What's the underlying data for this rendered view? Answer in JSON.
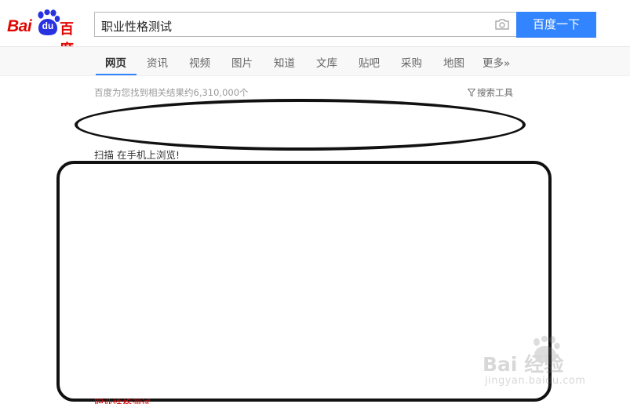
{
  "logo": {
    "latin": "Bai",
    "du": "du",
    "chinese": "百度"
  },
  "search": {
    "value": "职业性格测试",
    "button_label": "百度一下"
  },
  "nav": {
    "tabs": [
      {
        "label": "网页",
        "active": true
      },
      {
        "label": "资讯"
      },
      {
        "label": "视频"
      },
      {
        "label": "图片"
      },
      {
        "label": "知道"
      },
      {
        "label": "文库"
      },
      {
        "label": "贴吧"
      },
      {
        "label": "采购"
      },
      {
        "label": "地图"
      },
      {
        "label": "更多»"
      }
    ]
  },
  "results": {
    "count_text": "百度为您找到相关结果约6,310,000个",
    "tools_label": "搜索工具",
    "scan_text": "扫描 在手机上浏览!",
    "bottom_peek_text": "职业性格测试"
  },
  "watermark": {
    "main": "Bai 经验",
    "sub": "jingyan.baidu.com"
  },
  "colors": {
    "brand_red": "#e10601",
    "brand_blue": "#3385ff",
    "blue_brand": "#2932e1"
  },
  "icons": {
    "camera": "camera-icon",
    "funnel": "funnel-icon",
    "paw": "paw-icon"
  }
}
